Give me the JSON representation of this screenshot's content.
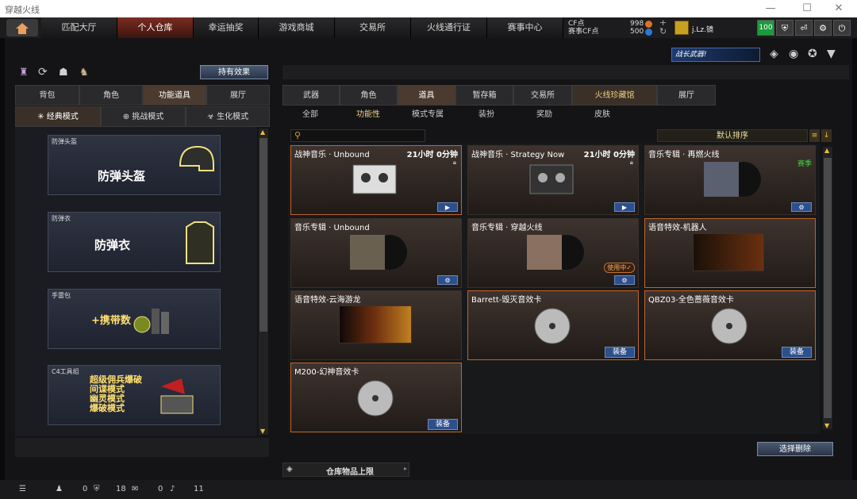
{
  "window": {
    "title": "穿越火线",
    "minimize": "—",
    "maximize": "☐",
    "close": "✕"
  },
  "nav": {
    "tabs": [
      "匹配大厅",
      "个人仓库",
      "幸运抽奖",
      "游戏商城",
      "交易所",
      "火线通行证",
      "赛事中心"
    ],
    "active": 1
  },
  "account": {
    "cf_label": "CF点",
    "cf_value": "998",
    "match_label": "赛事CF点",
    "match_value": "500",
    "user": "j.Lz.镜",
    "level": "100"
  },
  "banner": "战长武器!",
  "left": {
    "effect_button": "持有效果",
    "tabs": [
      "背包",
      "角色",
      "功能道具",
      "展厅"
    ],
    "mode_tabs": [
      "经典模式",
      "挑战模式",
      "生化模式"
    ],
    "cards": [
      {
        "caption": "防弹头盔",
        "title": "防弹头盔"
      },
      {
        "caption": "防弹衣",
        "title": "防弹衣"
      },
      {
        "caption": "手雷包",
        "title": "+携带数"
      },
      {
        "caption": "C4工具组",
        "lines": [
          "超级佣兵爆破",
          "间谍模式",
          "幽灵模式",
          "爆破模式"
        ]
      }
    ]
  },
  "right": {
    "tabs": [
      "武器",
      "角色",
      "道具",
      "暂存箱",
      "交易所",
      "火线珍藏馆",
      "展厅"
    ],
    "subtabs": [
      "全部",
      "功能性",
      "模式专属",
      "装扮",
      "奖励",
      "皮肤"
    ],
    "sort": "默认排序",
    "items": [
      {
        "name": "战神音乐 · Unbound",
        "time": "21小时 0分钟",
        "action": "▶"
      },
      {
        "name": "战神音乐 · Strategy Now",
        "time": "21小时 0分钟",
        "action": "▶"
      },
      {
        "name": "音乐专辑 · 再燃火线",
        "badge": "赛季",
        "action": "⚙"
      },
      {
        "name": "音乐专辑 · Unbound",
        "action": "⚙"
      },
      {
        "name": "音乐专辑 · 穿越火线",
        "status": "使用中✓",
        "action": "⚙"
      },
      {
        "name": "语音特效-机器人"
      },
      {
        "name": "语音特效-云海游龙"
      },
      {
        "name": "Barrett-毁灭音效卡",
        "action": "装备"
      },
      {
        "name": "QBZ03-全色蔷薇音效卡",
        "action": "装备"
      },
      {
        "name": "M200-幻神音效卡",
        "action": "装备"
      }
    ],
    "clear_button": "选择删除",
    "limit_label": "仓库物品上限"
  },
  "status": {
    "v1": "0",
    "v2": "18",
    "v3": "0",
    "v4": "11"
  }
}
